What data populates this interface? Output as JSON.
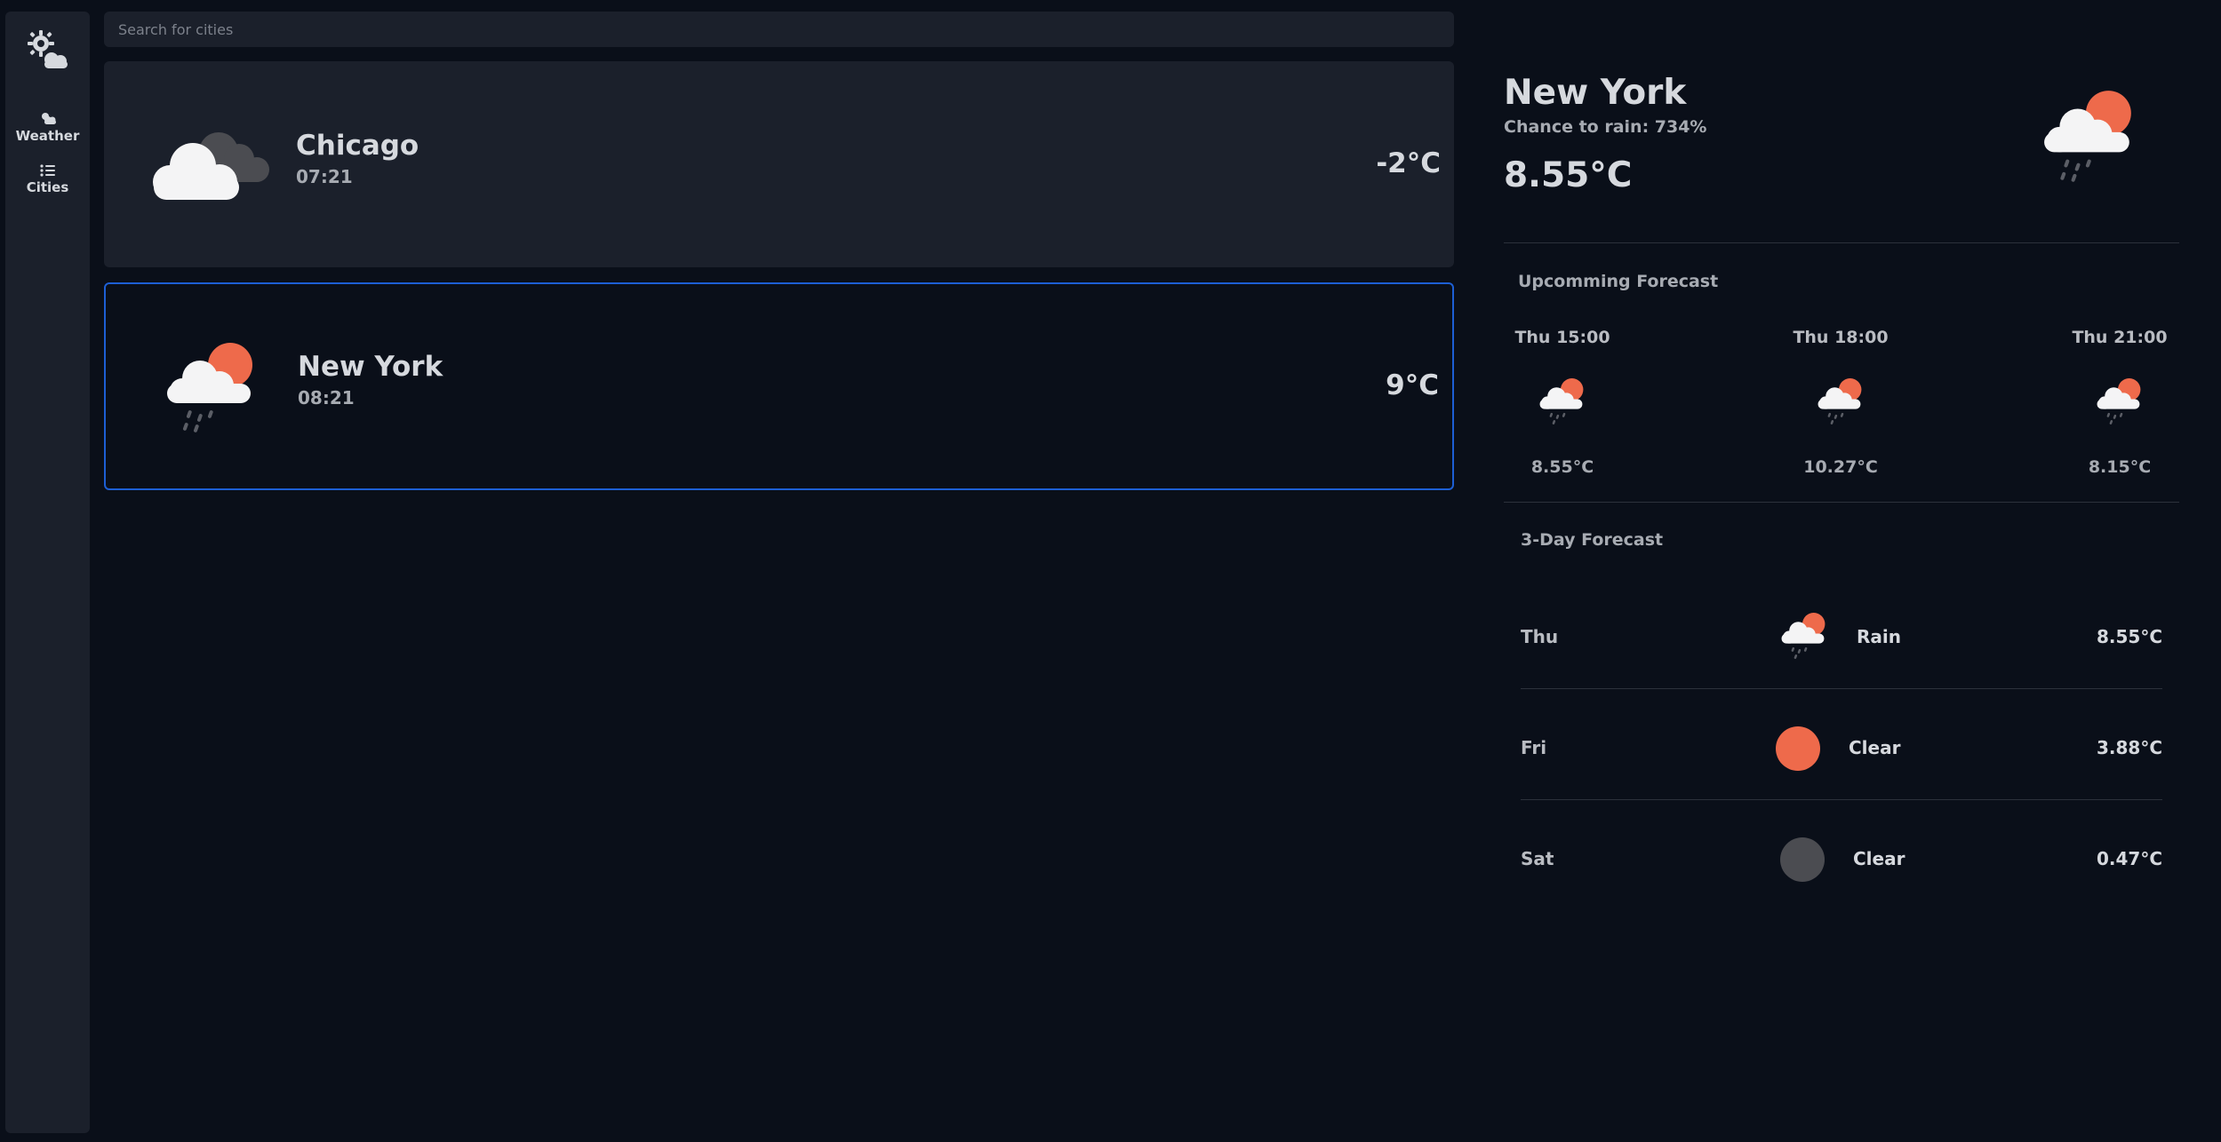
{
  "sidebar": {
    "logo_icon": "sun-cloud-gear-icon",
    "items": [
      {
        "label": "Weather",
        "icon": "cloud-sun-icon"
      },
      {
        "label": "Cities",
        "icon": "list-icon"
      }
    ]
  },
  "search": {
    "placeholder": "Search for cities",
    "value": ""
  },
  "cities": [
    {
      "name": "Chicago",
      "time": "07:21",
      "temp": "-2°C",
      "icon": "cloudy-icon",
      "selected": false
    },
    {
      "name": "New York",
      "time": "08:21",
      "temp": "9°C",
      "icon": "rain-sun-icon",
      "selected": true
    }
  ],
  "detail": {
    "city": "New York",
    "rain": "Chance to rain: 734%",
    "temp": "8.55°C",
    "icon": "rain-sun-icon"
  },
  "upcoming": {
    "title": "Upcomming Forecast",
    "items": [
      {
        "time": "Thu 15:00",
        "temp": "8.55°C",
        "icon": "rain-sun-icon"
      },
      {
        "time": "Thu 18:00",
        "temp": "10.27°C",
        "icon": "rain-sun-icon"
      },
      {
        "time": "Thu 21:00",
        "temp": "8.15°C",
        "icon": "rain-sun-icon"
      }
    ]
  },
  "three_day": {
    "title": "3-Day Forecast",
    "days": [
      {
        "day": "Thu",
        "condition": "Rain",
        "temp": "8.55°C",
        "icon": "rain-sun-icon"
      },
      {
        "day": "Fri",
        "condition": "Clear",
        "temp": "3.88°C",
        "icon": "sun-icon"
      },
      {
        "day": "Sat",
        "condition": "Clear",
        "temp": "0.47°C",
        "icon": "moon-icon"
      }
    ]
  },
  "colors": {
    "background": "#0a0f19",
    "panel": "#1b202b",
    "accent_border": "#1d5fd4",
    "sun": "#ee6a4b",
    "moon": "#4b4c51",
    "text": "#d6d9de",
    "muted": "#a7abb2"
  }
}
